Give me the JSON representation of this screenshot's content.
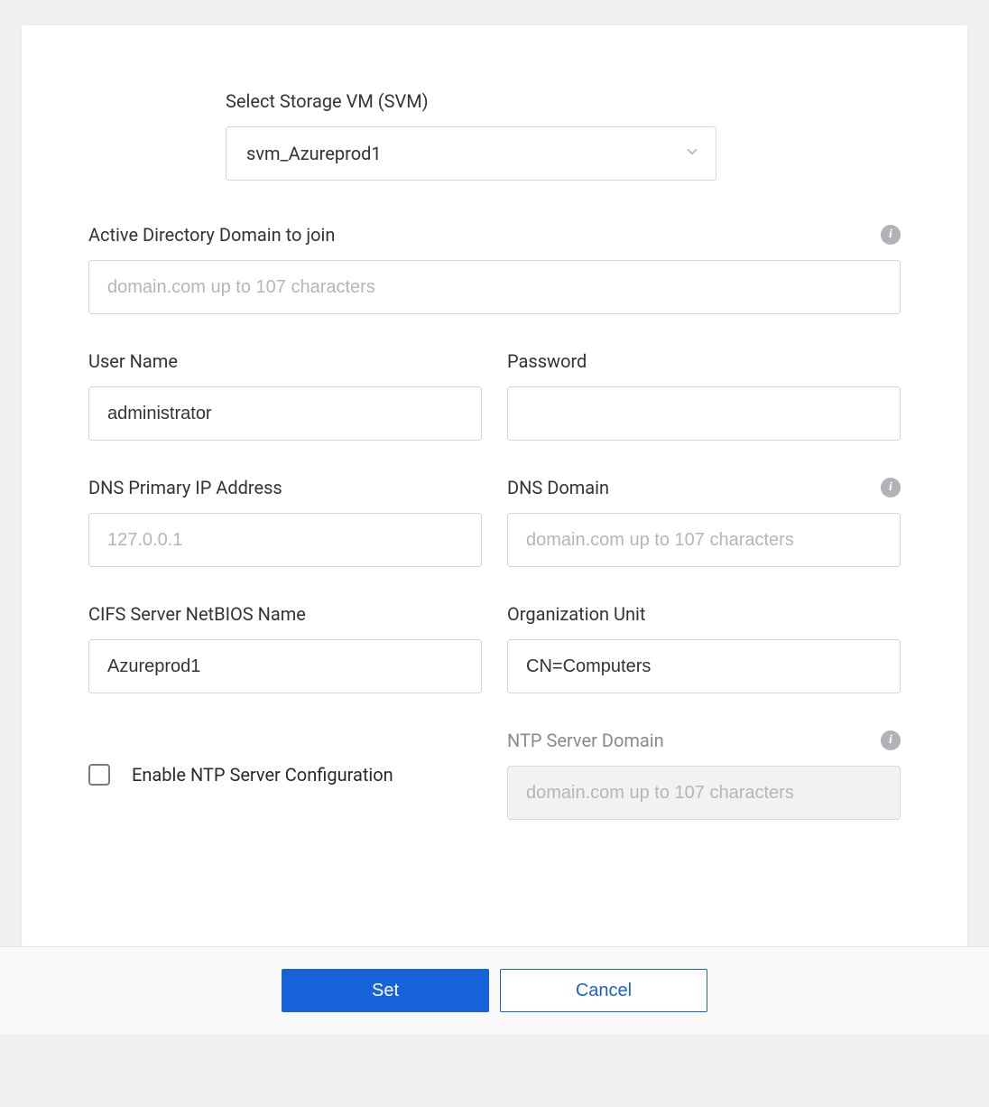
{
  "svm": {
    "label": "Select Storage VM (SVM)",
    "selected": "svm_Azureprod1"
  },
  "ad_domain": {
    "label": "Active Directory Domain to join",
    "placeholder": "domain.com up to 107 characters",
    "value": ""
  },
  "username": {
    "label": "User Name",
    "value": "administrator"
  },
  "password": {
    "label": "Password",
    "value": ""
  },
  "dns_ip": {
    "label": "DNS Primary IP Address",
    "placeholder": "127.0.0.1",
    "value": ""
  },
  "dns_domain": {
    "label": "DNS Domain",
    "placeholder": "domain.com up to 107 characters",
    "value": ""
  },
  "netbios": {
    "label": "CIFS Server NetBIOS Name",
    "value": "Azureprod1"
  },
  "ou": {
    "label": "Organization Unit",
    "value": "CN=Computers"
  },
  "ntp_enable": {
    "label": "Enable NTP Server Configuration",
    "checked": false
  },
  "ntp_domain": {
    "label": "NTP Server Domain",
    "placeholder": "domain.com up to 107 characters",
    "value": ""
  },
  "buttons": {
    "set": "Set",
    "cancel": "Cancel"
  }
}
